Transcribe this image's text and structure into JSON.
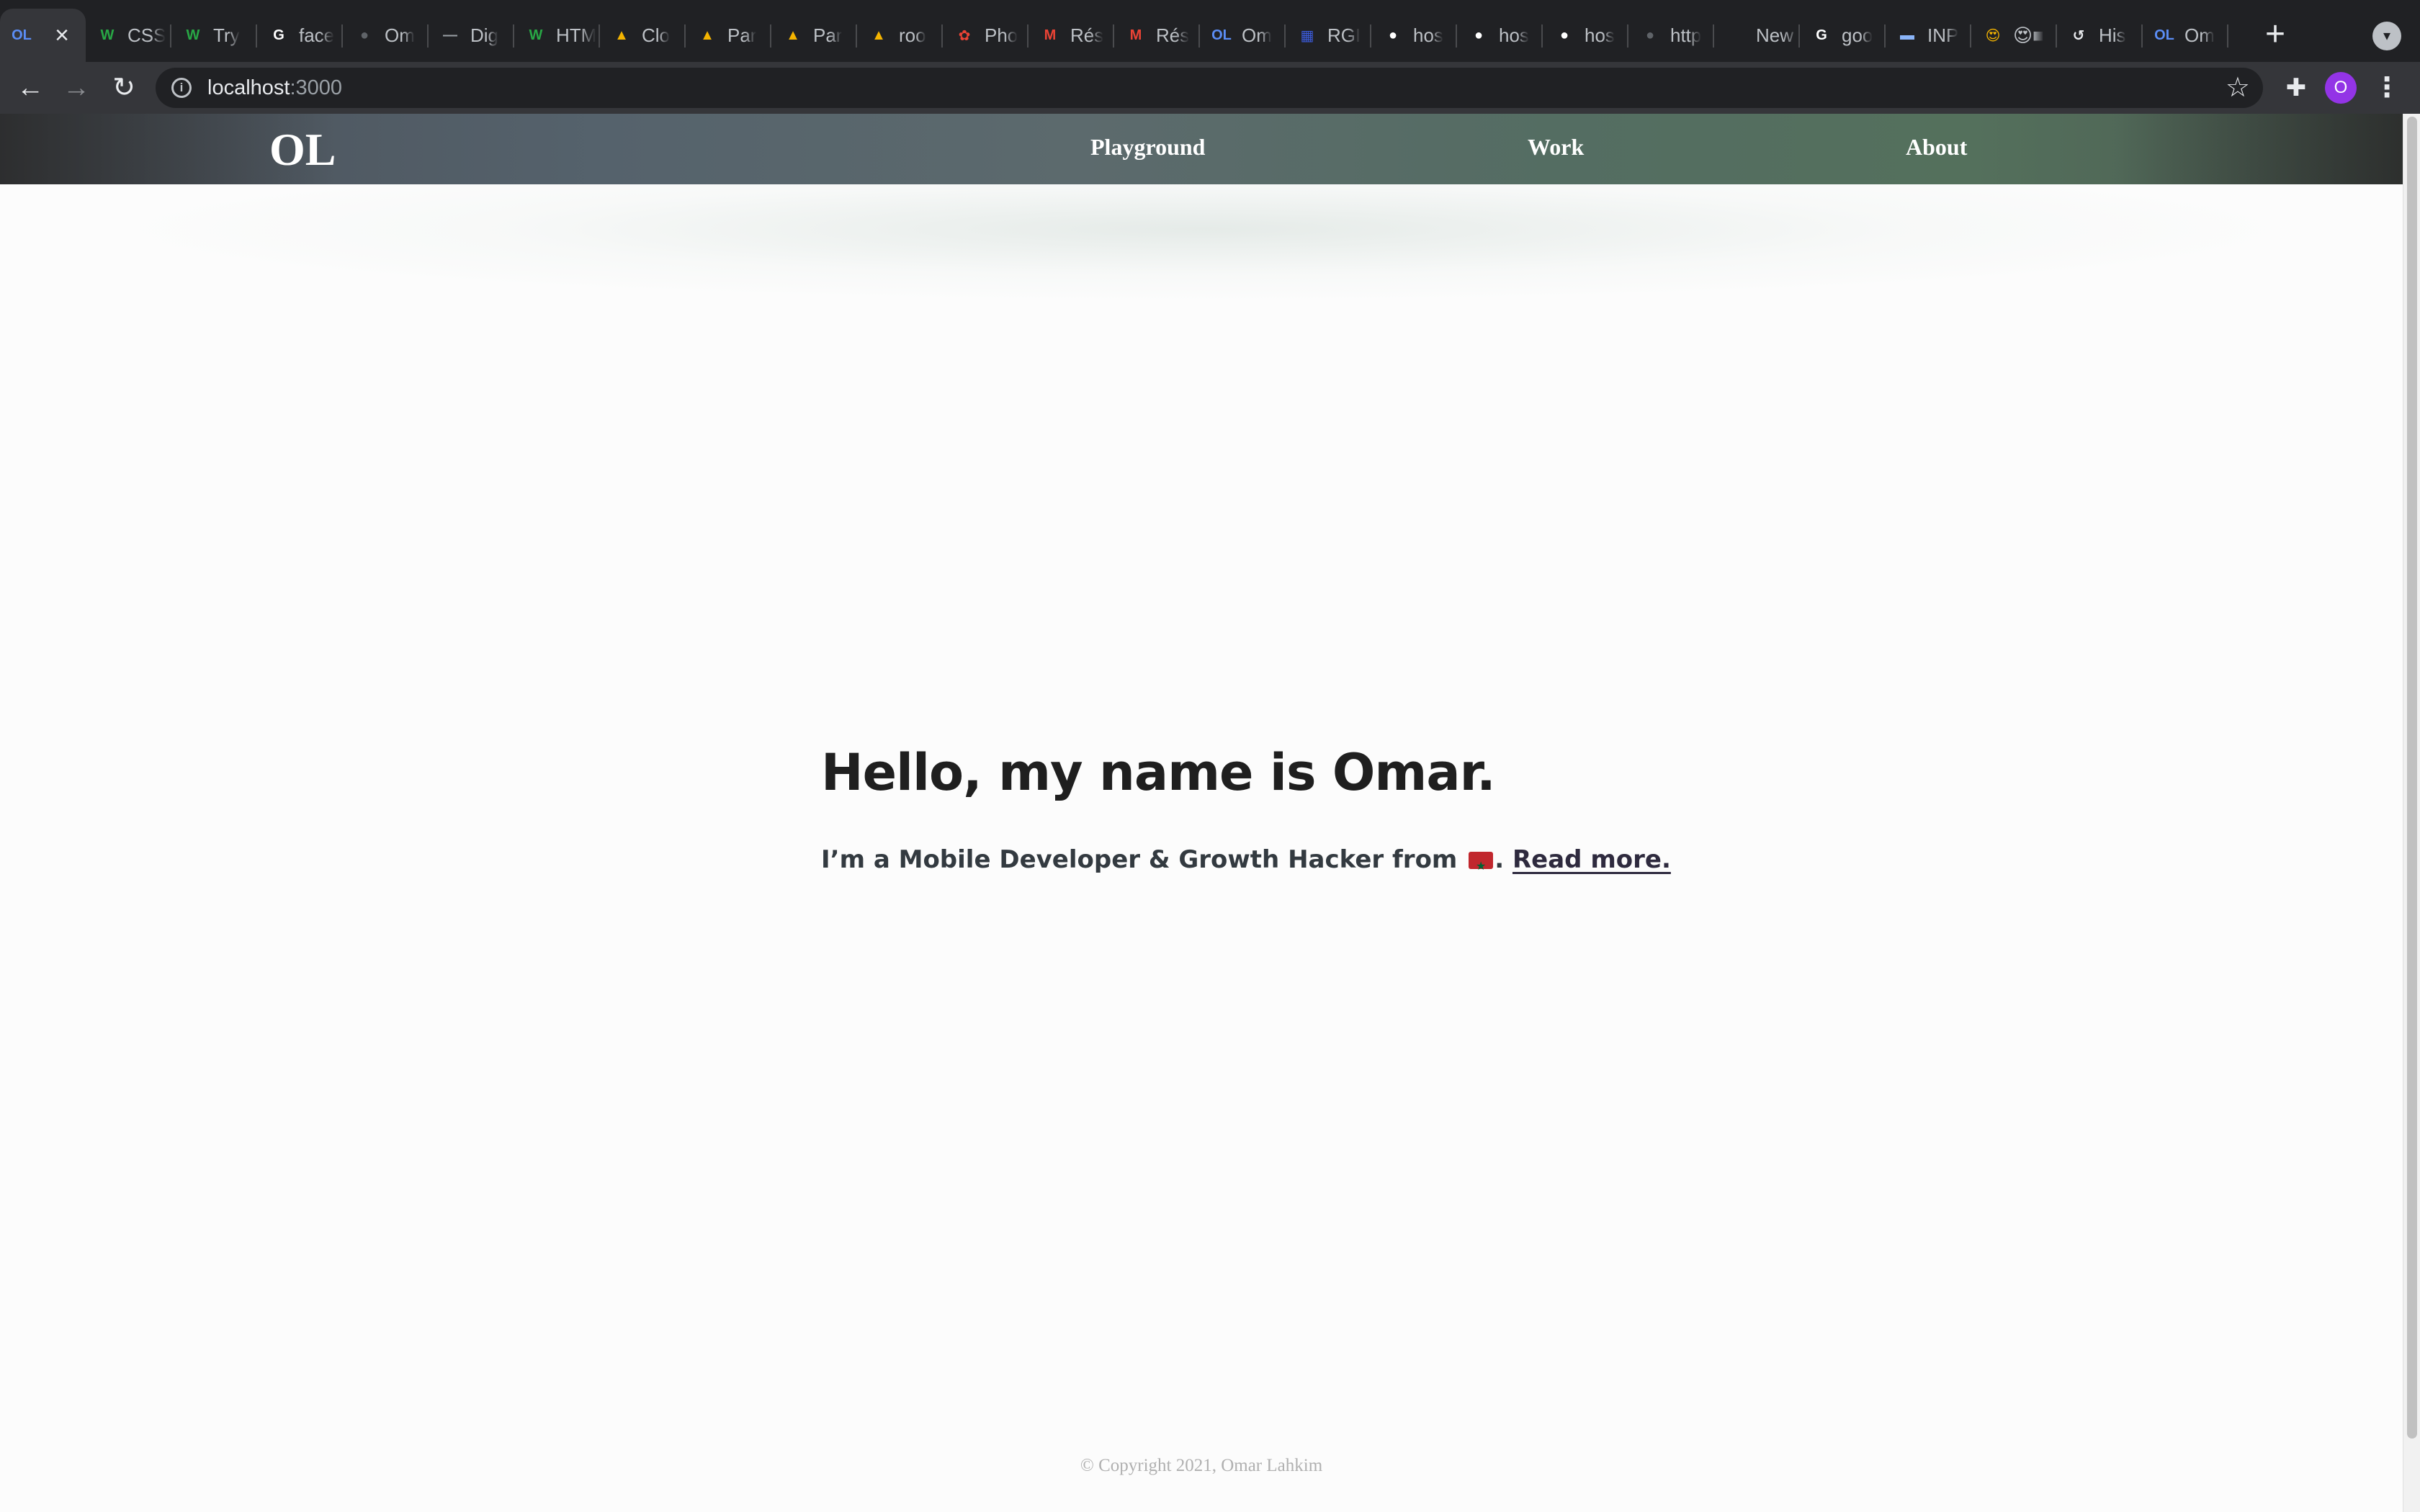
{
  "browser": {
    "tabs": [
      {
        "title": "OL",
        "favicon": "OL",
        "favicon_color": "#5b8df5",
        "active": true
      },
      {
        "title": "CSS",
        "favicon": "W",
        "favicon_color": "#28a745"
      },
      {
        "title": "Try",
        "favicon": "W",
        "favicon_color": "#28a745"
      },
      {
        "title": "face",
        "favicon": "G",
        "favicon_color": "#ffffff"
      },
      {
        "title": "Om",
        "favicon": "●",
        "favicon_color": "#5f6368"
      },
      {
        "title": "Dig",
        "favicon": "—",
        "favicon_color": "#9aa0a6"
      },
      {
        "title": "HTM",
        "favicon": "W",
        "favicon_color": "#28a745"
      },
      {
        "title": "Clo",
        "favicon": "▲",
        "favicon_color": "#f4b400"
      },
      {
        "title": "Par",
        "favicon": "▲",
        "favicon_color": "#f4b400"
      },
      {
        "title": "Par",
        "favicon": "▲",
        "favicon_color": "#f4b400"
      },
      {
        "title": "roo",
        "favicon": "▲",
        "favicon_color": "#f4b400"
      },
      {
        "title": "Pho",
        "favicon": "✿",
        "favicon_color": "#ea4335"
      },
      {
        "title": "Rés",
        "favicon": "M",
        "favicon_color": "#ea4335"
      },
      {
        "title": "Rés",
        "favicon": "M",
        "favicon_color": "#ea4335"
      },
      {
        "title": "Om",
        "favicon": "OL",
        "favicon_color": "#5b8df5"
      },
      {
        "title": "RGI",
        "favicon": "▦",
        "favicon_color": "#3b5bdb"
      },
      {
        "title": "hos",
        "favicon": "●",
        "favicon_color": "#ffffff"
      },
      {
        "title": "hos",
        "favicon": "●",
        "favicon_color": "#ffffff"
      },
      {
        "title": "hos",
        "favicon": "●",
        "favicon_color": "#ffffff"
      },
      {
        "title": "http",
        "favicon": "●",
        "favicon_color": "#5f6368"
      },
      {
        "title": "New Ta",
        "favicon": "",
        "favicon_color": "#ffffff"
      },
      {
        "title": "goo",
        "favicon": "G",
        "favicon_color": "#ffffff"
      },
      {
        "title": "INP",
        "favicon": "▬",
        "favicon_color": "#8ab4f8"
      },
      {
        "title": "😍■",
        "favicon": "😍",
        "favicon_color": "#f4b400"
      },
      {
        "title": "His",
        "favicon": "↺",
        "favicon_color": "#e8eaed"
      },
      {
        "title": "Om",
        "favicon": "OL",
        "favicon_color": "#5b8df5"
      }
    ],
    "url_host": "localhost",
    "url_port": ":3000",
    "icons": {
      "back": "←",
      "forward": "→",
      "reload": "↻",
      "info": "i",
      "star": "☆",
      "extensions": "✚",
      "menu": "⋮",
      "new_tab": "+",
      "tab_search": "▾",
      "close_tab": "×"
    },
    "profile_initial": "O"
  },
  "site": {
    "logo": "OL",
    "nav": [
      "Playground",
      "Work",
      "About"
    ],
    "hero": {
      "title": "Hello, my name is Omar.",
      "subtitle_prefix": "I’m a Mobile Developer & Growth Hacker from ",
      "subtitle_suffix": ". ",
      "flag": "morocco-flag-icon",
      "link_label": "Read more."
    },
    "footer": "© Copyright 2021, Omar Lahkim"
  },
  "colors": {
    "heading": "#1f1f1f",
    "subtitle": "#333a40",
    "link": "#2e2a3e",
    "footer": "#b0b0b0",
    "profile": "#9334e6",
    "flag_red": "#c1272d",
    "flag_green": "#006233"
  }
}
